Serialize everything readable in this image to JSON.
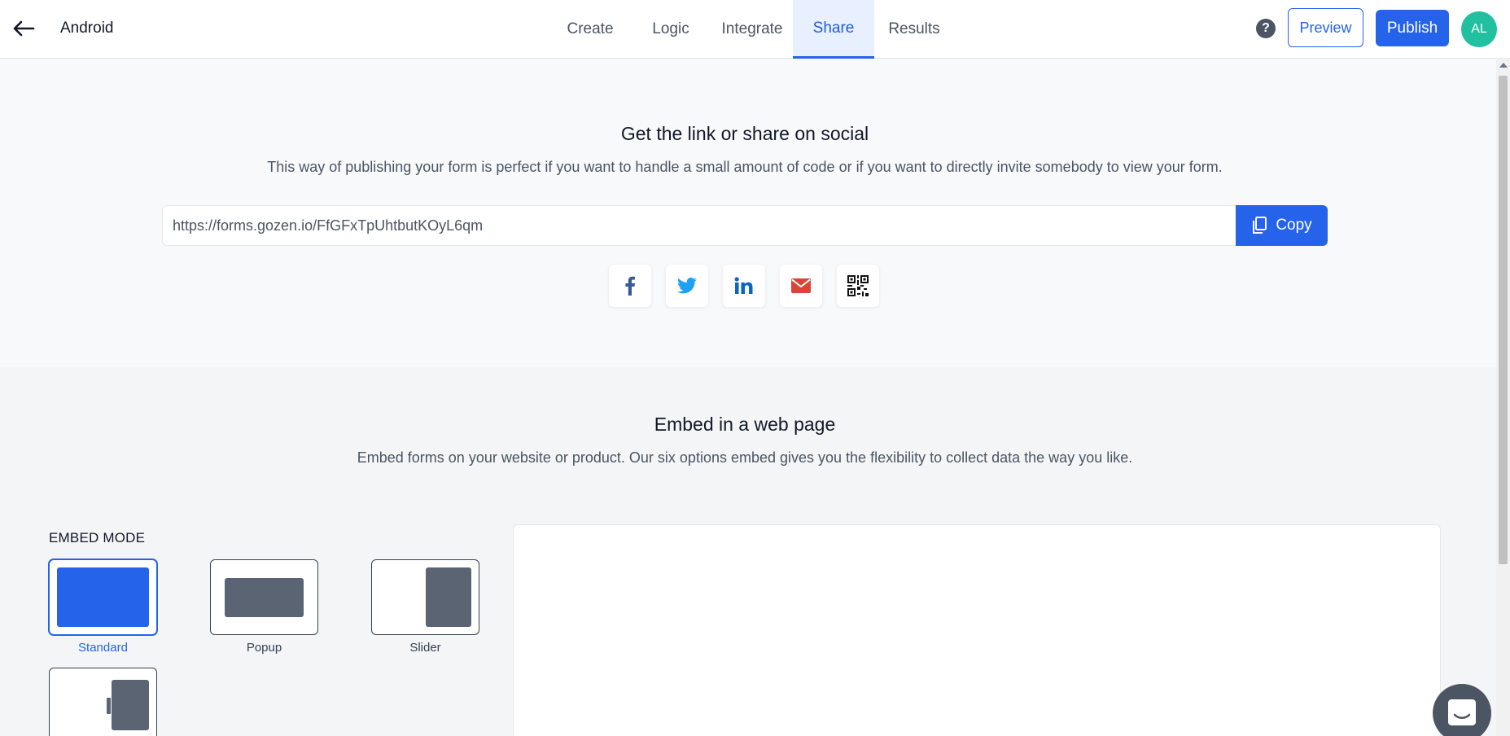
{
  "header": {
    "form_name": "Android",
    "tabs": [
      {
        "label": "Create"
      },
      {
        "label": "Logic"
      },
      {
        "label": "Integrate"
      },
      {
        "label": "Share"
      },
      {
        "label": "Results"
      }
    ],
    "active_tab": "Share",
    "preview_label": "Preview",
    "publish_label": "Publish",
    "avatar_initials": "AL"
  },
  "share": {
    "title": "Get the link or share on social",
    "description": "This way of publishing your form is perfect if you want to handle a small amount of code or if you want to directly invite somebody to view your form.",
    "url": "https://forms.gozen.io/FfGFxTpUhtbutKOyL6qm",
    "copy_label": "Copy",
    "social_icons": [
      "facebook-icon",
      "twitter-icon",
      "linkedin-icon",
      "email-icon",
      "qr-code-icon"
    ]
  },
  "embed": {
    "title": "Embed in a web page",
    "description": "Embed forms on your website or product. Our six options embed gives you the flexibility to collect data the way you like.",
    "mode_heading": "EMBED MODE",
    "modes": [
      {
        "label": "Standard",
        "selected": true
      },
      {
        "label": "Popup",
        "selected": false
      },
      {
        "label": "Slider",
        "selected": false
      },
      {
        "label": "",
        "selected": false
      }
    ]
  },
  "colors": {
    "primary": "#2563eb",
    "avatar": "#20c0a0",
    "mode_fill": "#5b6472",
    "facebook": "#3b5998",
    "twitter": "#1da1f2",
    "linkedin": "#0a66c2",
    "email": "#db4437"
  }
}
